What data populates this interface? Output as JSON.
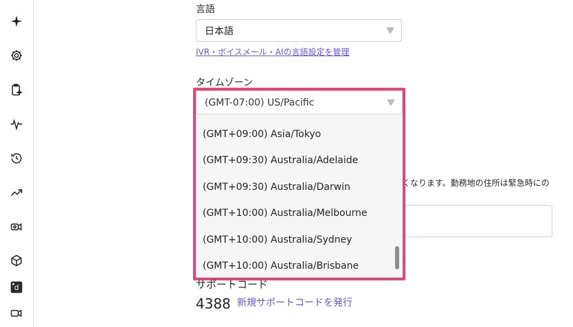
{
  "sidebar": {
    "icons": [
      {
        "name": "ai-sparkle-icon"
      },
      {
        "name": "settings-gear-icon"
      },
      {
        "name": "clipboard-sparkle-icon"
      },
      {
        "name": "pulse-activity-icon"
      },
      {
        "name": "history-icon"
      },
      {
        "name": "trending-up-icon"
      },
      {
        "name": "video-settings-icon"
      },
      {
        "name": "cube-icon"
      },
      {
        "name": "d-app-icon"
      },
      {
        "name": "video-camera-icon"
      }
    ]
  },
  "language": {
    "label": "言語",
    "selected": "日本語",
    "manage_link": "IVR・ボイスメール・AIの言語設定を管理"
  },
  "timezone": {
    "label": "タイムゾーン",
    "selected": "(GMT-07:00) US/Pacific",
    "options": [
      "(GMT+09:00) Asia/Tokyo",
      "(GMT+09:30) Australia/Adelaide",
      "(GMT+09:30) Australia/Darwin",
      "(GMT+10:00) Australia/Melbourne",
      "(GMT+10:00) Australia/Sydney",
      "(GMT+10:00) Australia/Brisbane"
    ]
  },
  "address_notice": "くなります。勤務地の住所は緊急時にの",
  "support": {
    "label": "サポートコード",
    "code": "4388",
    "new_link": "新規サポートコードを発行"
  },
  "colors": {
    "highlight": "#e0467c",
    "link": "#6b55d6"
  }
}
